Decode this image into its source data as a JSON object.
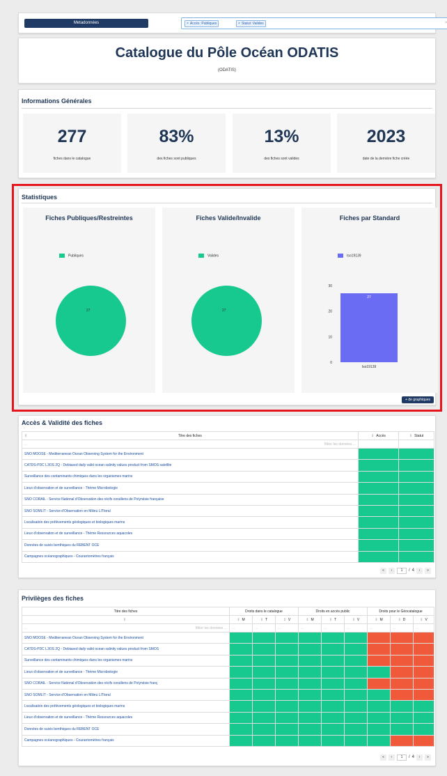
{
  "topbar": {
    "metadata_button": "Metadonnées",
    "filters": [
      {
        "label": "Accès :Publiques"
      },
      {
        "label": "Statut :Valides"
      }
    ],
    "clear_label": "× ▾"
  },
  "header": {
    "title": "Catalogue du Pôle Océan ODATIS",
    "subtitle": "(ODATIS)"
  },
  "info": {
    "section_title": "Informations Générales",
    "cards": [
      {
        "value": "277",
        "label": "fiches dans le catalogue"
      },
      {
        "value": "83%",
        "label": "des fiches sont publiques"
      },
      {
        "value": "13%",
        "label": "des fiches sont valides"
      },
      {
        "value": "2023",
        "label": "date de la dernière fiche créée"
      }
    ]
  },
  "stats": {
    "section_title": "Statistiques",
    "more_button": "+ de graphiques"
  },
  "chart_data": [
    {
      "type": "pie",
      "title": "Fiches Publiques/Restreintes",
      "slices": [
        {
          "label": "Publiques",
          "value": 27
        }
      ],
      "colors": [
        "#17c98e"
      ],
      "legend": "top-left"
    },
    {
      "type": "pie",
      "title": "Fiches Valide/Invalide",
      "slices": [
        {
          "label": "Valides",
          "value": 27
        }
      ],
      "colors": [
        "#17c98e"
      ],
      "legend": "top-left"
    },
    {
      "type": "bar",
      "title": "Fiches par Standard",
      "categories": [
        "Iso19139"
      ],
      "series": [
        {
          "name": "Iso19139",
          "values": [
            27
          ]
        }
      ],
      "colors": [
        "#6b6cf4"
      ],
      "y_ticks": [
        0,
        10,
        20,
        30
      ],
      "ylim": [
        0,
        30
      ],
      "grid": false,
      "legend": "top-left"
    }
  ],
  "access_table": {
    "section_title": "Accès & Validité des fiches",
    "columns": [
      "Titre des fiches",
      "Accès",
      "Statut"
    ],
    "filter_placeholder": "filtrer les données ...",
    "filter_mark": "...",
    "sort_icon": "⇕",
    "rows": [
      "SNO MOOSE - Mediterranean Ocean Observing System for the Environment",
      "CATDS-PDC L3OS 2Q - Debiased daily valid ocean salinity values product from SMOS satellite",
      "Surveillance des contaminants chimiques dans les organismes marins",
      "Lieux d'observation et de surveillance - Thème Microbiologie",
      "SNO CORAIL - Service National d'Observation des récifs coralliens de Polynésie française",
      "SNO SOMLIT - Service d'Observation en Milieu LITtoral",
      "Localisation des prélèvements géologiques et biologiques marins",
      "Lieux d'observation et de surveillance - Thème Ressources aquacoles",
      "Données de suivis benthiques du REBENT OCE",
      "Campagnes océanographiques - Courantomètres français"
    ],
    "status_color": "#17c98e",
    "pager": {
      "first": "«",
      "prev": "‹",
      "page": "1",
      "sep": "/",
      "total": "4",
      "next": "›",
      "last": "»"
    }
  },
  "privileges_table": {
    "section_title": "Privilèges des fiches",
    "title_col": "Titre des fiches",
    "groups": [
      "Droits dans le catalogue",
      "Droits en accès public",
      "Droits pour le Géocatalogue"
    ],
    "sub_columns": [
      "M",
      "T",
      "V",
      "M",
      "T",
      "V",
      "M",
      "D",
      "V"
    ],
    "filter_placeholder": "filtrer les données ...",
    "filter_mark": "...",
    "sort_icon": "⇕",
    "rows": [
      {
        "title": "SNO MOOSE - Mediterranean Ocean Observing System for the Environment",
        "cells": [
          "g",
          "g",
          "g",
          "g",
          "g",
          "g",
          "r",
          "r",
          "r"
        ]
      },
      {
        "title": "CATDS-PDC L3OS 2Q - Debiased daily valid ocean salinity values product from SMOS",
        "cells": [
          "g",
          "g",
          "g",
          "g",
          "g",
          "g",
          "r",
          "r",
          "r"
        ]
      },
      {
        "title": "Surveillance des contaminants chimiques dans les organismes marins",
        "cells": [
          "g",
          "g",
          "g",
          "g",
          "g",
          "g",
          "r",
          "r",
          "r"
        ]
      },
      {
        "title": "Lieux d'observation et de surveillance - Thème Microbiologie",
        "cells": [
          "g",
          "g",
          "g",
          "g",
          "g",
          "g",
          "g",
          "r",
          "r"
        ]
      },
      {
        "title": "SNO CORAIL - Service National d'Observation des récifs coralliens de Polynésie franç",
        "cells": [
          "g",
          "g",
          "g",
          "g",
          "g",
          "g",
          "r",
          "r",
          "r"
        ]
      },
      {
        "title": "SNO SOMLIT - Service d'Observation en Milieu LITtoral",
        "cells": [
          "g",
          "g",
          "g",
          "g",
          "g",
          "g",
          "g",
          "r",
          "r"
        ]
      },
      {
        "title": "Localisation des prélèvements géologiques et biologiques marins",
        "cells": [
          "g",
          "g",
          "g",
          "g",
          "g",
          "g",
          "g",
          "g",
          "g"
        ]
      },
      {
        "title": "Lieux d'observation et de surveillance - Thème Ressources aquacoles",
        "cells": [
          "g",
          "g",
          "g",
          "g",
          "g",
          "g",
          "g",
          "g",
          "g"
        ]
      },
      {
        "title": "Données de suivis benthiques du REBENT OCE",
        "cells": [
          "g",
          "g",
          "g",
          "g",
          "g",
          "g",
          "g",
          "g",
          "g"
        ]
      },
      {
        "title": "Campagnes océanographiques - Courantomètres français",
        "cells": [
          "g",
          "g",
          "g",
          "g",
          "g",
          "g",
          "g",
          "r",
          "r"
        ]
      }
    ],
    "colors": {
      "granted": "#17c98e",
      "denied": "#f05a3a"
    },
    "pager": {
      "first": "«",
      "prev": "‹",
      "page": "1",
      "sep": "/",
      "total": "4",
      "next": "›",
      "last": "»"
    }
  }
}
